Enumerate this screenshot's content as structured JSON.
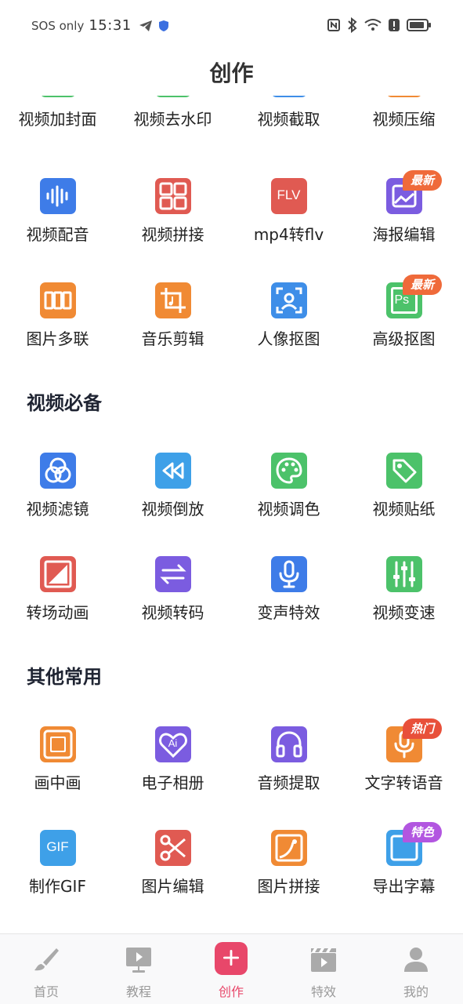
{
  "status": {
    "carrier": "SOS only",
    "time": "15:31"
  },
  "page": {
    "title": "创作"
  },
  "partial_row": [
    "视频加封面",
    "视频去水印",
    "视频截取",
    "视频压缩"
  ],
  "row2": [
    "视频配音",
    "视频拼接",
    "mp4转flv",
    "海报编辑"
  ],
  "row3": [
    "图片多联",
    "音乐剪辑",
    "人像抠图",
    "高级抠图"
  ],
  "section1": {
    "title": "视频必备",
    "row1": [
      "视频滤镜",
      "视频倒放",
      "视频调色",
      "视频贴纸"
    ],
    "row2": [
      "转场动画",
      "视频转码",
      "变声特效",
      "视频变速"
    ]
  },
  "section2": {
    "title": "其他常用",
    "row1": [
      "画中画",
      "电子相册",
      "音频提取",
      "文字转语音"
    ],
    "row2": [
      "制作GIF",
      "图片编辑",
      "图片拼接",
      "导出字幕"
    ]
  },
  "badges": {
    "new": "最新",
    "hot": "热门",
    "special": "特色"
  },
  "icon_text": {
    "flv": "FLV",
    "gif": "GIF",
    "ai": "Ai",
    "ps": "Ps"
  },
  "tabs": [
    "首页",
    "教程",
    "创作",
    "特效",
    "我的"
  ],
  "colors": {
    "accent": "#e8476a",
    "blue": "#3e7ce8",
    "red": "#e05a52",
    "orange": "#f08a34",
    "green": "#4cc26a",
    "purple": "#7b5ce0"
  }
}
